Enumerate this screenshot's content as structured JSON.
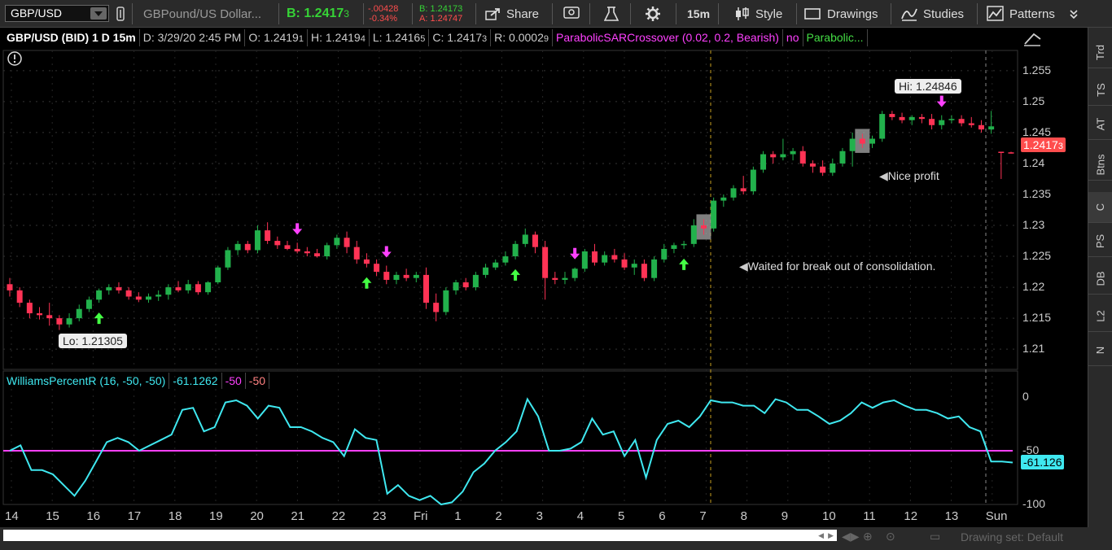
{
  "toolbar": {
    "symbol": "GBP/USD",
    "description": "GBPound/US Dollar...",
    "bid_label": "B: 1.2417",
    "bid_last": "3",
    "net_change": "-.00428",
    "pct_change": "-0.34%",
    "bid_small": "B: 1.24173",
    "ask_small": "A: 1.24747",
    "share": "Share",
    "timeframe": "15m",
    "style": "Style",
    "drawings": "Drawings",
    "studies": "Studies",
    "patterns": "Patterns"
  },
  "infobar": {
    "title": "GBP/USD (BID) 1 D 15m",
    "date": "D: 3/29/20 2:45 PM",
    "open": "O: 1.2419",
    "open_last": "1",
    "high": "H: 1.2419",
    "high_last": "4",
    "low": "L: 1.2416",
    "low_last": "5",
    "close": "C: 1.2417",
    "close_last": "3",
    "range": "R: 0.0002",
    "range_last": "9",
    "study": "ParabolicSARCrossover (0.02, 0.2, Bearish)",
    "no": "no",
    "study2": "Parabolic..."
  },
  "studybar": {
    "name": "WilliamsPercentR (16, -50, -50)",
    "value": "-61.1262",
    "over": "-50",
    "under": "-50"
  },
  "annotations": {
    "hi": "Hi: 1.24846",
    "lo": "Lo: 1.21305",
    "nice_profit": "Nice profit",
    "waited": "Waited for break out of consolidation.",
    "price_badge": "1.2417",
    "price_badge_last": "3",
    "wpr_badge": "-61.126"
  },
  "price_axis": [
    "1.255",
    "1.25",
    "1.245",
    "1.24",
    "1.235",
    "1.23",
    "1.225",
    "1.22",
    "1.215",
    "1.21"
  ],
  "wpr_axis": [
    "0",
    "-50",
    "-100"
  ],
  "x_axis": [
    "14",
    "15",
    "16",
    "17",
    "18",
    "19",
    "20",
    "21",
    "22",
    "23",
    "Fri",
    "1",
    "2",
    "3",
    "4",
    "5",
    "6",
    "7",
    "8",
    "9",
    "10",
    "11",
    "12",
    "13",
    "Sun"
  ],
  "side_tabs": [
    "Trd",
    "TS",
    "AT",
    "Btns",
    "C",
    "PS",
    "DB",
    "L2",
    "N"
  ],
  "bottom": {
    "drawing_set": "Drawing set: Default"
  },
  "colors": {
    "up": "#22b14c",
    "down": "#ff3355",
    "wpr": "#3fe8f0",
    "level": "#ff40ff",
    "buy_arrow": "#44ff44",
    "sell_arrow": "#ff40ff"
  },
  "chart_data": {
    "type": "candlestick",
    "price_ylim": [
      1.207,
      1.258
    ],
    "wpr_ylim": [
      -100,
      0
    ],
    "candles": [
      [
        1.2205,
        1.2215,
        1.2185,
        1.2195
      ],
      [
        1.2195,
        1.22,
        1.2168,
        1.2175
      ],
      [
        1.2175,
        1.218,
        1.215,
        1.2158
      ],
      [
        1.2158,
        1.2168,
        1.2148,
        1.2155
      ],
      [
        1.2155,
        1.2175,
        1.2138,
        1.215
      ],
      [
        1.215,
        1.2155,
        1.2131,
        1.214
      ],
      [
        1.214,
        1.2158,
        1.2135,
        1.215
      ],
      [
        1.215,
        1.2172,
        1.2145,
        1.2165
      ],
      [
        1.2165,
        1.2185,
        1.216,
        1.218
      ],
      [
        1.218,
        1.2198,
        1.2175,
        1.2195
      ],
      [
        1.2195,
        1.2205,
        1.2188,
        1.22
      ],
      [
        1.22,
        1.2208,
        1.219,
        1.2195
      ],
      [
        1.2195,
        1.22,
        1.218,
        1.2185
      ],
      [
        1.2185,
        1.2192,
        1.2176,
        1.218
      ],
      [
        1.218,
        1.219,
        1.2175,
        1.2185
      ],
      [
        1.2185,
        1.2195,
        1.2178,
        1.2188
      ],
      [
        1.2188,
        1.2205,
        1.218,
        1.22
      ],
      [
        1.22,
        1.221,
        1.2192,
        1.2195
      ],
      [
        1.2195,
        1.2212,
        1.219,
        1.2205
      ],
      [
        1.2205,
        1.221,
        1.2188,
        1.2192
      ],
      [
        1.2192,
        1.221,
        1.2188,
        1.2208
      ],
      [
        1.2208,
        1.2235,
        1.2205,
        1.2232
      ],
      [
        1.2232,
        1.2265,
        1.2228,
        1.226
      ],
      [
        1.226,
        1.2275,
        1.2252,
        1.227
      ],
      [
        1.227,
        1.2275,
        1.2255,
        1.226
      ],
      [
        1.226,
        1.23,
        1.2255,
        1.2292
      ],
      [
        1.2292,
        1.2305,
        1.227,
        1.2275
      ],
      [
        1.2275,
        1.2282,
        1.2262,
        1.2268
      ],
      [
        1.2268,
        1.2275,
        1.226,
        1.2262
      ],
      [
        1.2262,
        1.2272,
        1.2255,
        1.2258
      ],
      [
        1.2258,
        1.2265,
        1.225,
        1.2255
      ],
      [
        1.2255,
        1.2262,
        1.2248,
        1.225
      ],
      [
        1.225,
        1.2272,
        1.2245,
        1.2268
      ],
      [
        1.2268,
        1.2285,
        1.2262,
        1.228
      ],
      [
        1.228,
        1.229,
        1.2255,
        1.2265
      ],
      [
        1.2265,
        1.2275,
        1.2238,
        1.2245
      ],
      [
        1.2245,
        1.2255,
        1.2232,
        1.2238
      ],
      [
        1.2238,
        1.2245,
        1.2218,
        1.2225
      ],
      [
        1.2225,
        1.2235,
        1.2205,
        1.2212
      ],
      [
        1.2212,
        1.2225,
        1.2205,
        1.222
      ],
      [
        1.222,
        1.223,
        1.221,
        1.2215
      ],
      [
        1.2215,
        1.2225,
        1.2208,
        1.222
      ],
      [
        1.222,
        1.2232,
        1.2165,
        1.2175
      ],
      [
        1.2175,
        1.219,
        1.2145,
        1.216
      ],
      [
        1.216,
        1.22,
        1.2155,
        1.2195
      ],
      [
        1.2195,
        1.2212,
        1.2188,
        1.2208
      ],
      [
        1.2208,
        1.2215,
        1.2195,
        1.22
      ],
      [
        1.22,
        1.2225,
        1.2195,
        1.222
      ],
      [
        1.222,
        1.2238,
        1.2215,
        1.2232
      ],
      [
        1.2232,
        1.2245,
        1.2228,
        1.224
      ],
      [
        1.224,
        1.2258,
        1.2235,
        1.225
      ],
      [
        1.225,
        1.2275,
        1.2245,
        1.227
      ],
      [
        1.227,
        1.2295,
        1.2265,
        1.2285
      ],
      [
        1.2285,
        1.229,
        1.2255,
        1.2265
      ],
      [
        1.2265,
        1.2275,
        1.218,
        1.2215
      ],
      [
        1.2215,
        1.2225,
        1.2205,
        1.2212
      ],
      [
        1.2212,
        1.2225,
        1.2205,
        1.2215
      ],
      [
        1.2215,
        1.2232,
        1.221,
        1.223
      ],
      [
        1.223,
        1.2262,
        1.2225,
        1.2258
      ],
      [
        1.2258,
        1.227,
        1.2235,
        1.224
      ],
      [
        1.224,
        1.2258,
        1.2235,
        1.2252
      ],
      [
        1.2252,
        1.2262,
        1.224,
        1.2245
      ],
      [
        1.2245,
        1.2255,
        1.2228,
        1.2232
      ],
      [
        1.2232,
        1.2245,
        1.222,
        1.2238
      ],
      [
        1.2238,
        1.2245,
        1.221,
        1.2215
      ],
      [
        1.2215,
        1.225,
        1.221,
        1.2245
      ],
      [
        1.2245,
        1.227,
        1.224,
        1.2262
      ],
      [
        1.2262,
        1.2272,
        1.2255,
        1.2268
      ],
      [
        1.2268,
        1.2275,
        1.2262,
        1.227
      ],
      [
        1.227,
        1.231,
        1.2265,
        1.23
      ],
      [
        1.23,
        1.231,
        1.2285,
        1.2295
      ],
      [
        1.2295,
        1.2345,
        1.229,
        1.234
      ],
      [
        1.234,
        1.235,
        1.233,
        1.2345
      ],
      [
        1.2345,
        1.2365,
        1.234,
        1.236
      ],
      [
        1.236,
        1.238,
        1.235,
        1.2355
      ],
      [
        1.2355,
        1.2395,
        1.235,
        1.239
      ],
      [
        1.239,
        1.242,
        1.2385,
        1.2415
      ],
      [
        1.2415,
        1.242,
        1.24,
        1.241
      ],
      [
        1.241,
        1.244,
        1.2405,
        1.2415
      ],
      [
        1.2415,
        1.2425,
        1.2405,
        1.242
      ],
      [
        1.242,
        1.2428,
        1.2395,
        1.24
      ],
      [
        1.24,
        1.2405,
        1.2385,
        1.2395
      ],
      [
        1.2395,
        1.2405,
        1.238,
        1.2385
      ],
      [
        1.2385,
        1.2408,
        1.238,
        1.24
      ],
      [
        1.24,
        1.2425,
        1.2395,
        1.242
      ],
      [
        1.242,
        1.245,
        1.2395,
        1.244
      ],
      [
        1.244,
        1.2448,
        1.2425,
        1.2432
      ],
      [
        1.2432,
        1.2445,
        1.2425,
        1.244
      ],
      [
        1.244,
        1.2485,
        1.2435,
        1.248
      ],
      [
        1.248,
        1.2485,
        1.247,
        1.2475
      ],
      [
        1.2475,
        1.2482,
        1.2465,
        1.247
      ],
      [
        1.247,
        1.2478,
        1.2462,
        1.2475
      ],
      [
        1.2475,
        1.248,
        1.2465,
        1.2472
      ],
      [
        1.2472,
        1.248,
        1.2455,
        1.2462
      ],
      [
        1.2462,
        1.2478,
        1.2455,
        1.247
      ],
      [
        1.247,
        1.2478,
        1.2465,
        1.2472
      ],
      [
        1.2472,
        1.2478,
        1.246,
        1.2465
      ],
      [
        1.2465,
        1.2475,
        1.2458,
        1.2462
      ],
      [
        1.2462,
        1.247,
        1.245,
        1.2455
      ],
      [
        1.2455,
        1.2485,
        1.2448,
        1.246
      ],
      [
        1.2419,
        1.2419,
        1.2375,
        1.2418
      ],
      [
        1.2418,
        1.2419,
        1.2416,
        1.2417
      ]
    ],
    "wpr": [
      -50,
      -45,
      -68,
      -68,
      -72,
      -82,
      -92,
      -78,
      -60,
      -42,
      -38,
      -42,
      -50,
      -45,
      -40,
      -35,
      -12,
      -10,
      -32,
      -28,
      -5,
      -3,
      -8,
      -20,
      -8,
      -10,
      -28,
      -28,
      -32,
      -38,
      -42,
      -55,
      -30,
      -38,
      -40,
      -90,
      -82,
      -92,
      -96,
      -92,
      -100,
      -98,
      -88,
      -70,
      -62,
      -50,
      -42,
      -32,
      -2,
      -18,
      -50,
      -50,
      -48,
      -42,
      -20,
      -35,
      -32,
      -55,
      -40,
      -75,
      -40,
      -25,
      -22,
      -28,
      -18,
      -3,
      -5,
      -5,
      -8,
      -8,
      -15,
      -2,
      -5,
      -12,
      -12,
      -18,
      -25,
      -22,
      -15,
      -5,
      -10,
      -5,
      -3,
      -8,
      -12,
      -12,
      -15,
      -20,
      -18,
      -28,
      -32,
      -60,
      -60,
      -61
    ],
    "buy_signals": [
      9,
      36,
      51,
      68
    ],
    "sell_signals": [
      29,
      38,
      57,
      94
    ]
  }
}
